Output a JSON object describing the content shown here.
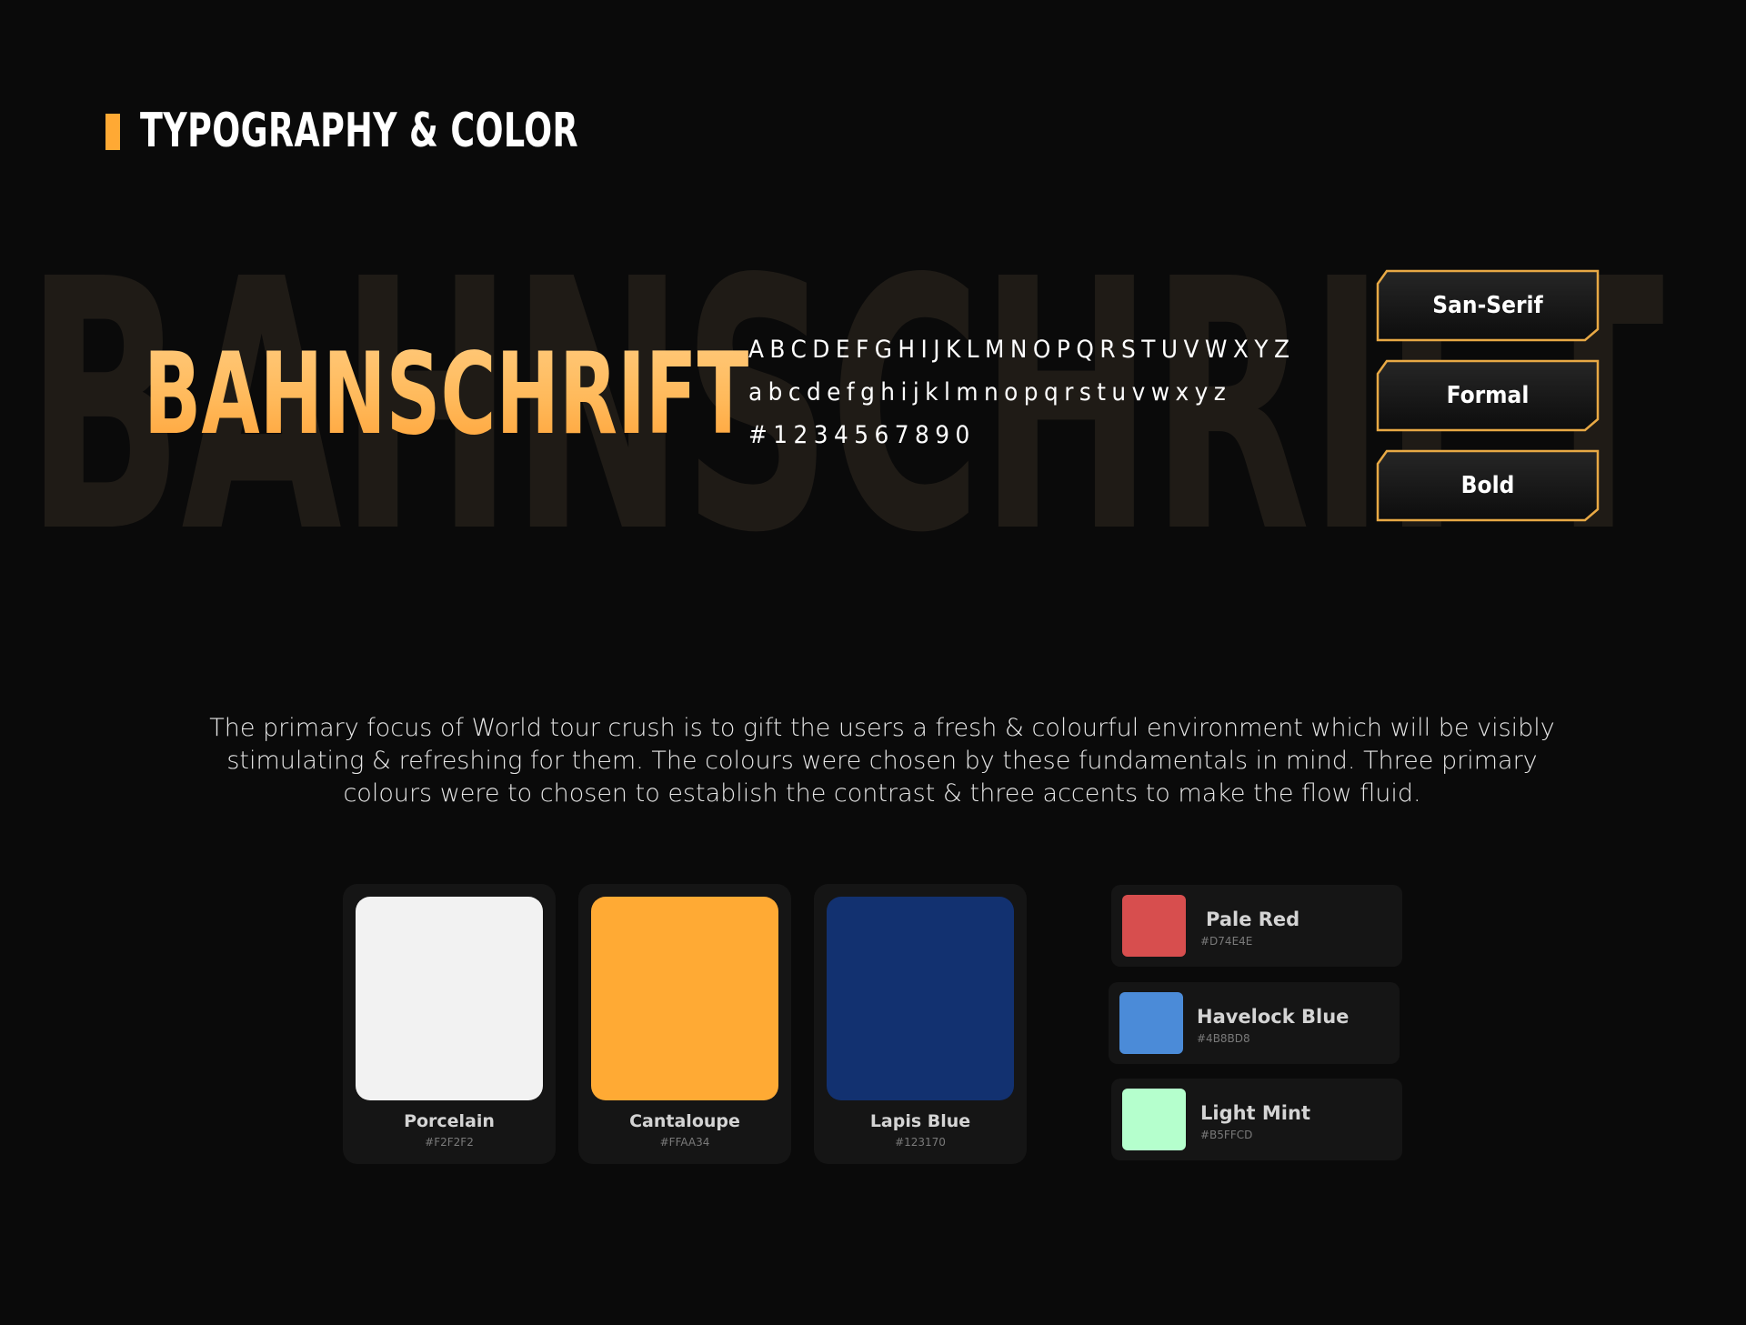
{
  "header": {
    "title": "TYPOGRAPHY & COLOR"
  },
  "typography": {
    "background_word": "BAHNSCHRIFT",
    "font_name": "BAHNSCHRIFT",
    "uppercase": "ABCDEFGHIJKLMNOPQRSTUVWXYZ",
    "lowercase": "abcdefghijklmnopqrstuvwxyz",
    "numbers": "#1234567890",
    "tags": [
      {
        "label": "San-Serif"
      },
      {
        "label": "Formal"
      },
      {
        "label": "Bold"
      }
    ]
  },
  "description": "The primary focus of World tour crush is to gift the users a fresh & colourful environment which will be visibly stimulating & refreshing for them. The colours were chosen by these fundamentals in mind. Three primary colours were to chosen to establish the contrast & three accents to make the flow fluid.",
  "primary_colors": [
    {
      "name": "Porcelain",
      "hex": "#F2F2F2",
      "color": "#F2F2F2"
    },
    {
      "name": "Cantaloupe",
      "hex": "#FFAA34",
      "color": "#FFAA34"
    },
    {
      "name": "Lapis Blue",
      "hex": "#123170",
      "color": "#123170"
    }
  ],
  "accent_colors": [
    {
      "name": "Pale Red",
      "hex": "#D74E4E",
      "color": "#D74E4E"
    },
    {
      "name": "Havelock Blue",
      "hex": "#4B8BD8",
      "color": "#4B8BD8"
    },
    {
      "name": "Light Mint",
      "hex": "#B5FFCD",
      "color": "#B5FFCD"
    }
  ],
  "theme": {
    "background": "#0A0A0A",
    "accent": "#FFA934",
    "tag_border": "#E8A945"
  }
}
